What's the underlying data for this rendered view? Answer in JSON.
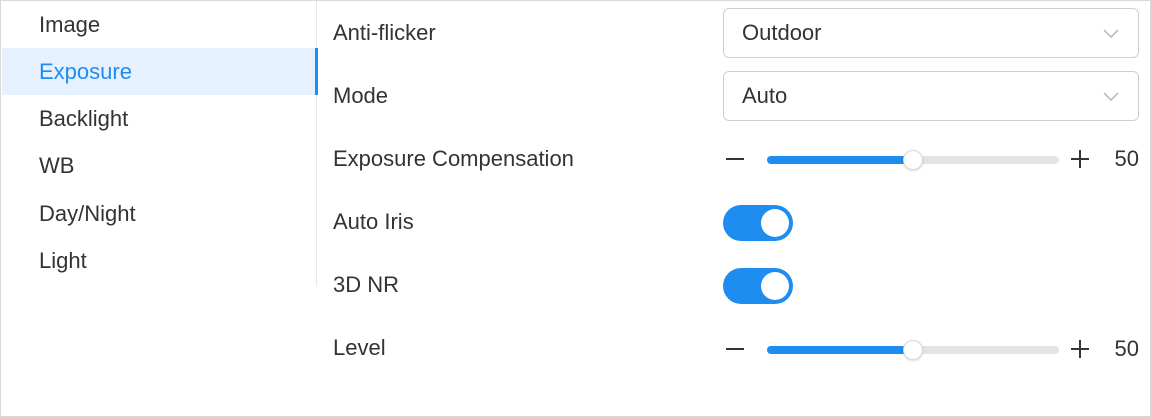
{
  "sidebar": {
    "items": [
      {
        "label": "Image"
      },
      {
        "label": "Exposure",
        "active": true
      },
      {
        "label": "Backlight"
      },
      {
        "label": "WB"
      },
      {
        "label": "Day/Night"
      },
      {
        "label": "Light"
      }
    ]
  },
  "settings": {
    "anti_flicker": {
      "label": "Anti-flicker",
      "value": "Outdoor",
      "icon": "chevron-down-icon"
    },
    "mode": {
      "label": "Mode",
      "value": "Auto",
      "icon": "chevron-down-icon"
    },
    "exposure_compensation": {
      "label": "Exposure Compensation",
      "value": "50",
      "min": 0,
      "max": 100
    },
    "auto_iris": {
      "label": "Auto Iris",
      "on": true
    },
    "nr_3d": {
      "label": "3D NR",
      "on": true
    },
    "level": {
      "label": "Level",
      "value": "50",
      "min": 0,
      "max": 100
    }
  },
  "colors": {
    "accent": "#1f8cf0",
    "active_bg": "#e6f1ff",
    "track": "#e3e3e8",
    "text": "#333333"
  }
}
